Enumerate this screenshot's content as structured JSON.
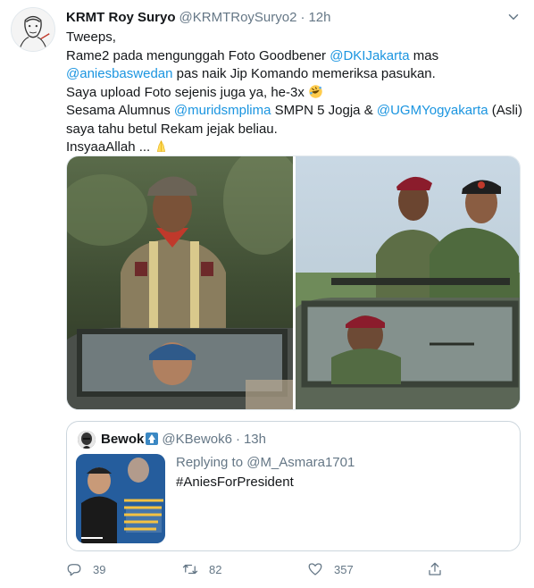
{
  "tweet": {
    "author_name": "KRMT Roy Suryo",
    "author_handle": "@KRMTRoySuryo2",
    "separator": "·",
    "time": "12h",
    "text": {
      "l1": "Tweeps,",
      "l2_pre": "Rame2 pada mengunggah Foto Goodbener ",
      "l2_link": "@DKIJakarta",
      "l2_post": " mas",
      "l3_link": "@aniesbaswedan",
      "l3_post": " pas naik Jip Komando memeriksa pasukan.",
      "l4": "Saya upload Foto sejenis juga yа, he-3x",
      "l5_pre": "Sesama Alumnus ",
      "l5_link1": "@muridsmplima",
      "l5_mid": " SMPN 5 Jogja & ",
      "l5_link2": "@UGMYogyakarta",
      "l5_post": " (Asli)",
      "l6": "saya tahu betul Rekam jejak beliau.",
      "l7": "InsyaaAllah ..."
    }
  },
  "quote": {
    "author_name": "Bewok",
    "author_handle": "@KBewok6",
    "separator": "·",
    "time": "13h",
    "replying_to": "Replying to @M_Asmara1701",
    "text": "#AniesForPresident"
  },
  "actions": {
    "reply_count": "39",
    "retweet_count": "82",
    "like_count": "357"
  },
  "icons": {
    "reply": "reply-icon",
    "retweet": "retweet-icon",
    "like": "heart-icon",
    "share": "share-icon",
    "caret": "chevron-down-icon",
    "emoji_laugh": "rofl-emoji-icon",
    "emoji_pray": "folded-hands-emoji-icon",
    "quote_badge": "up-arrow-badge-icon"
  },
  "colors": {
    "link": "#1b95e0",
    "secondary_text": "#657786",
    "border": "#ccd6dd"
  }
}
